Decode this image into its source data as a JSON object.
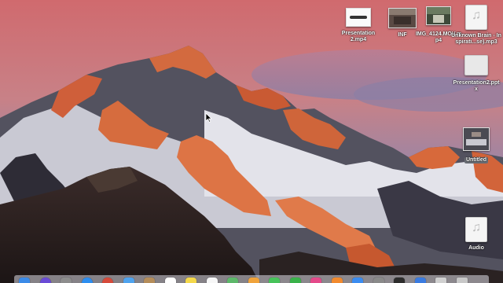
{
  "desktop": {
    "icons": [
      {
        "label": "Presentation2.mp4",
        "kind": "movie-file"
      },
      {
        "label": "INF",
        "kind": "movie-file"
      },
      {
        "label": "IMG_4124.MOV.mp4",
        "kind": "movie-file"
      },
      {
        "label": "Unknown Brain - Inspirati...se).mp3",
        "kind": "audio-file"
      },
      {
        "label": "Presentation2.pptx",
        "kind": "presentation-file"
      },
      {
        "label": "Untitled",
        "kind": "screenshot-file"
      },
      {
        "label": "Audio",
        "kind": "audio-file"
      }
    ]
  },
  "dock": {
    "apps": [
      {
        "name": "finder-icon",
        "color": "#3b8be8"
      },
      {
        "name": "siri-icon",
        "color": "#6a4bd6"
      },
      {
        "name": "launchpad-icon",
        "color": "#8d8d8d"
      },
      {
        "name": "safari-icon",
        "color": "#2d8ef0"
      },
      {
        "name": "chrome-icon",
        "color": "#d64a3a"
      },
      {
        "name": "mail-icon",
        "color": "#4fa3ee"
      },
      {
        "name": "contacts-icon",
        "color": "#b58d5a"
      },
      {
        "name": "calendar-icon",
        "color": "#ffffff"
      },
      {
        "name": "notes-icon",
        "color": "#f4d84a"
      },
      {
        "name": "reminders-icon",
        "color": "#f7f7f7"
      },
      {
        "name": "maps-icon",
        "color": "#5db86a"
      },
      {
        "name": "photos-icon",
        "color": "#f0a33b"
      },
      {
        "name": "messages-icon",
        "color": "#47c35a"
      },
      {
        "name": "facetime-icon",
        "color": "#3ab24a"
      },
      {
        "name": "itunes-icon",
        "color": "#e44a8a"
      },
      {
        "name": "ibooks-icon",
        "color": "#f28a2e"
      },
      {
        "name": "app-store-icon",
        "color": "#3b8cf0"
      },
      {
        "name": "system-preferences-icon",
        "color": "#8a8a8a"
      },
      {
        "name": "quicktime-icon",
        "color": "#2c2c2c"
      },
      {
        "name": "keynote-icon",
        "color": "#3a7be0"
      },
      {
        "name": "downloads-icon",
        "color": "#d0d0d0"
      },
      {
        "name": "trash-icon",
        "color": "#c8c8c8"
      }
    ]
  }
}
